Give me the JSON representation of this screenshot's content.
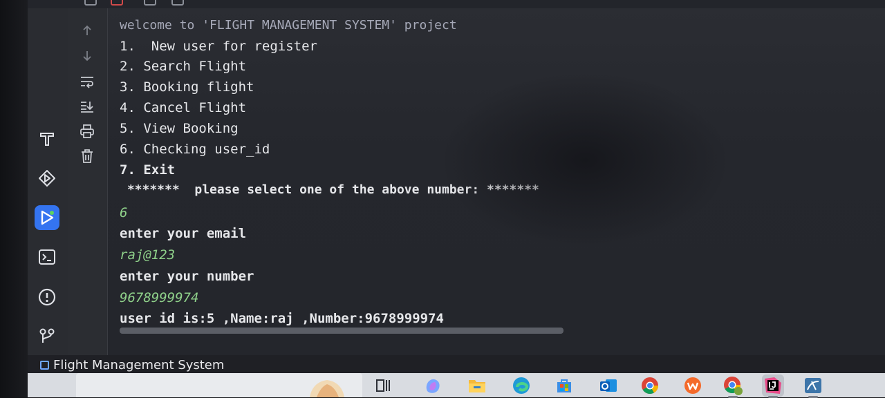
{
  "console": {
    "lines": [
      {
        "text": "welcome to 'FLIGHT MANAGEMENT SYSTEM' project",
        "kind": "header"
      },
      {
        "text": "1.  New user for register",
        "kind": "output"
      },
      {
        "text": "2. Search Flight",
        "kind": "output"
      },
      {
        "text": "3. Booking flight",
        "kind": "output"
      },
      {
        "text": "4. Cancel Flight",
        "kind": "output"
      },
      {
        "text": "5. View Booking",
        "kind": "output"
      },
      {
        "text": "6. Checking user_id",
        "kind": "output"
      },
      {
        "text": "7. Exit",
        "kind": "output"
      },
      {
        "text": " *******  please select one of the above number: *******",
        "kind": "bold"
      },
      {
        "text": "6",
        "kind": "input"
      },
      {
        "text": "enter your email",
        "kind": "bold"
      },
      {
        "text": "raj@123",
        "kind": "input"
      },
      {
        "text": "enter your number",
        "kind": "bold"
      },
      {
        "text": "9678999974",
        "kind": "input"
      },
      {
        "text": "user id is:5 ,Name:raj ,Number:9678999974",
        "kind": "bold"
      }
    ]
  },
  "left_rail": {
    "icons": [
      {
        "name": "build-hammer-icon"
      },
      {
        "name": "services-icon"
      },
      {
        "name": "run-icon",
        "active": true
      },
      {
        "name": "terminal-icon"
      },
      {
        "name": "problems-icon"
      },
      {
        "name": "git-icon"
      }
    ]
  },
  "console_tools": {
    "icons": [
      {
        "name": "scroll-up-icon"
      },
      {
        "name": "scroll-down-icon"
      },
      {
        "name": "soft-wrap-icon"
      },
      {
        "name": "scroll-to-end-icon"
      },
      {
        "name": "print-icon"
      },
      {
        "name": "clear-all-icon"
      }
    ]
  },
  "statusbar": {
    "project_name": "Flight Management System"
  },
  "taskbar": {
    "apps": [
      {
        "name": "task-view-icon"
      },
      {
        "name": "copilot-icon"
      },
      {
        "name": "file-explorer-icon"
      },
      {
        "name": "edge-icon"
      },
      {
        "name": "store-icon"
      },
      {
        "name": "outlook-icon"
      },
      {
        "name": "chrome-icon"
      },
      {
        "name": "wps-office-icon"
      },
      {
        "name": "chrome-profile-icon"
      },
      {
        "name": "intellij-icon"
      },
      {
        "name": "mysql-workbench-icon"
      }
    ]
  },
  "colors": {
    "accent": "#3474f0",
    "console_bg": "#2b2d33",
    "input_text": "#8fd18a",
    "output_text": "#e6e7ea"
  }
}
